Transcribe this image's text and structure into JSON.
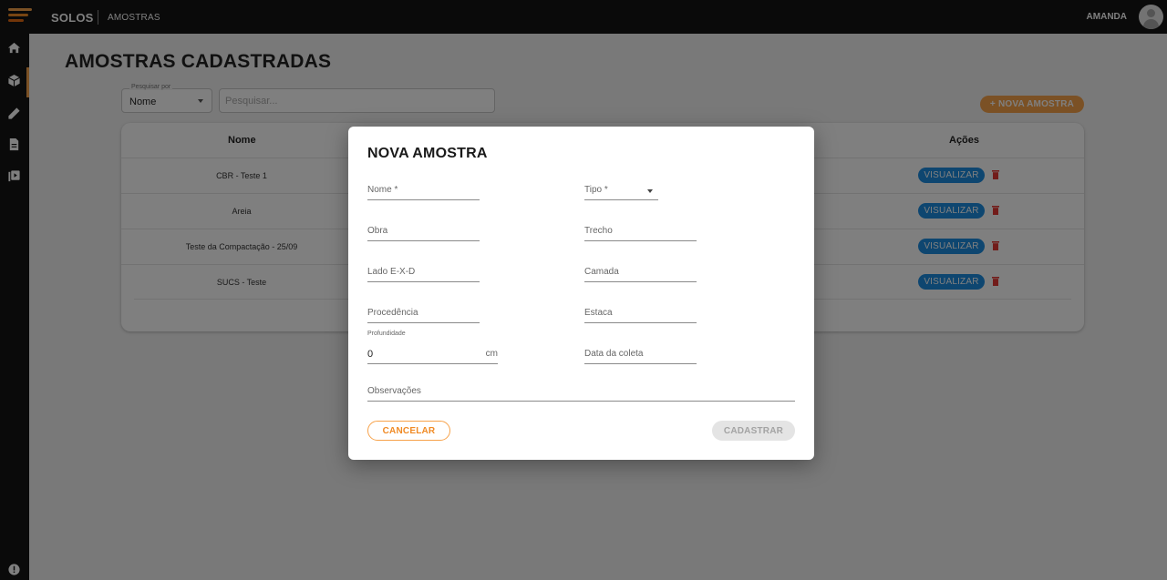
{
  "header": {
    "app_name": "SOLOS",
    "breadcrumb": "AMOSTRAS",
    "user_name": "AMANDA",
    "logo_colors": [
      "#f7a24a",
      "#f08a24",
      "#e56a12",
      "#d94d0a"
    ]
  },
  "sidebar": {
    "items": [
      {
        "icon": "home-icon",
        "active": false
      },
      {
        "icon": "cube-icon",
        "active": true
      },
      {
        "icon": "ruler-pencil-icon",
        "active": false
      },
      {
        "icon": "document-icon",
        "active": false
      },
      {
        "icon": "video-library-icon",
        "active": false
      }
    ],
    "footer_icon": "info-icon"
  },
  "main": {
    "title": "AMOSTRAS CADASTRADAS",
    "search_by_label": "Pesquisar por",
    "search_by_value": "Nome",
    "search_placeholder": "Pesquisar...",
    "new_button": "+ NOVA AMOSTRA",
    "table": {
      "headers": [
        "Nome",
        "Ações"
      ],
      "rows": [
        {
          "name": "CBR - Teste 1",
          "action": "VISUALIZAR"
        },
        {
          "name": "Areia",
          "action": "VISUALIZAR"
        },
        {
          "name": "Teste da Compactação - 25/09",
          "action": "VISUALIZAR"
        },
        {
          "name": "SUCS - Teste",
          "action": "VISUALIZAR"
        }
      ]
    }
  },
  "modal": {
    "title": "NOVA AMOSTRA",
    "fields": {
      "nome": "Nome *",
      "tipo": "Tipo *",
      "obra": "Obra",
      "trecho": "Trecho",
      "lado": "Lado E-X-D",
      "camada": "Camada",
      "procedencia": "Procedência",
      "estaca": "Estaca",
      "profundidade_label": "Profundidade",
      "profundidade_value": "0",
      "profundidade_unit": "cm",
      "data_coleta": "Data da coleta",
      "observacoes": "Observações"
    },
    "cancel_label": "CANCELAR",
    "submit_label": "CADASTRAR"
  },
  "colors": {
    "accent": "#f7a24a",
    "primary_button": "#1d8de0",
    "danger": "#e53935",
    "topbar": "#141414"
  }
}
